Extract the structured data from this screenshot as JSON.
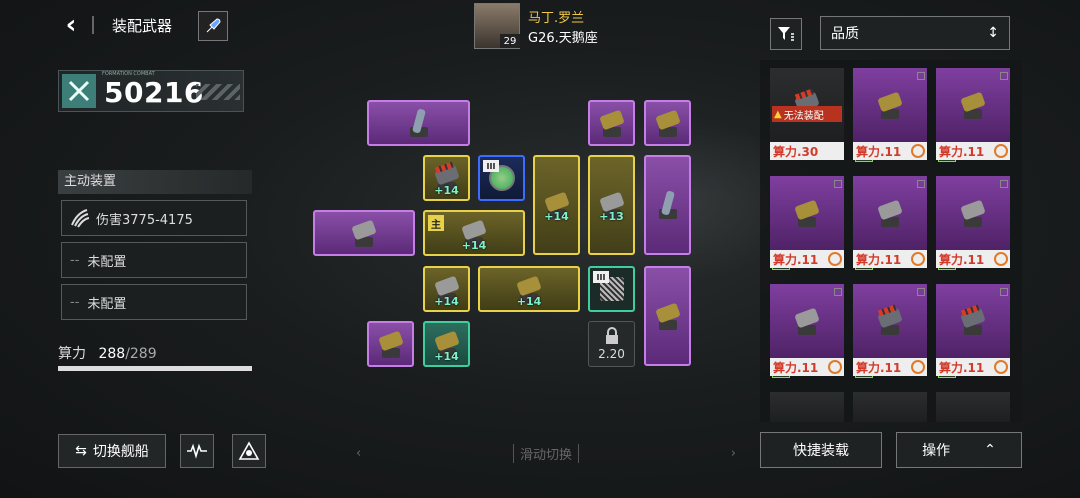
{
  "header": {
    "title": "装配武器"
  },
  "power": {
    "value": "50216",
    "tag": "FORMATION COMBAT"
  },
  "left": {
    "section_title": "主动装置",
    "slots": [
      {
        "label": "伤害3775-4175"
      },
      {
        "label": "未配置"
      },
      {
        "label": "未配置"
      }
    ],
    "capacity": {
      "label": "算力",
      "used": "288",
      "total": "/289",
      "fill_fraction": 1.0
    },
    "switch_label": "切换舰船"
  },
  "captain": {
    "name": "马丁.罗兰",
    "ship": "G26.天鹅座",
    "level": "29"
  },
  "grid": {
    "main_tag": "主",
    "tier_tag": "III",
    "boosts": [
      "+14",
      "+14",
      "+14",
      "+13",
      "+14",
      "+14",
      "+14"
    ],
    "lock_value": "2.20"
  },
  "swipe": {
    "left": "‹",
    "label": "滑动切换",
    "right": "›"
  },
  "inventory": {
    "sort_label": "品质",
    "warn_text": "无法装配",
    "items": [
      {
        "cost": "算力.30"
      },
      {
        "cost": "算力.11"
      },
      {
        "cost": "算力.11"
      },
      {
        "cost": "算力.11"
      },
      {
        "cost": "算力.11"
      },
      {
        "cost": "算力.11"
      },
      {
        "cost": "算力.11"
      },
      {
        "cost": "算力.11"
      },
      {
        "cost": "算力.11"
      }
    ]
  },
  "buttons": {
    "quick": "快捷装载",
    "op": "操作"
  },
  "colors": {
    "purple": "#8a4fa8",
    "gold": "#e8d24a",
    "teal": "#3fcf9f",
    "warn": "#b8331f"
  }
}
